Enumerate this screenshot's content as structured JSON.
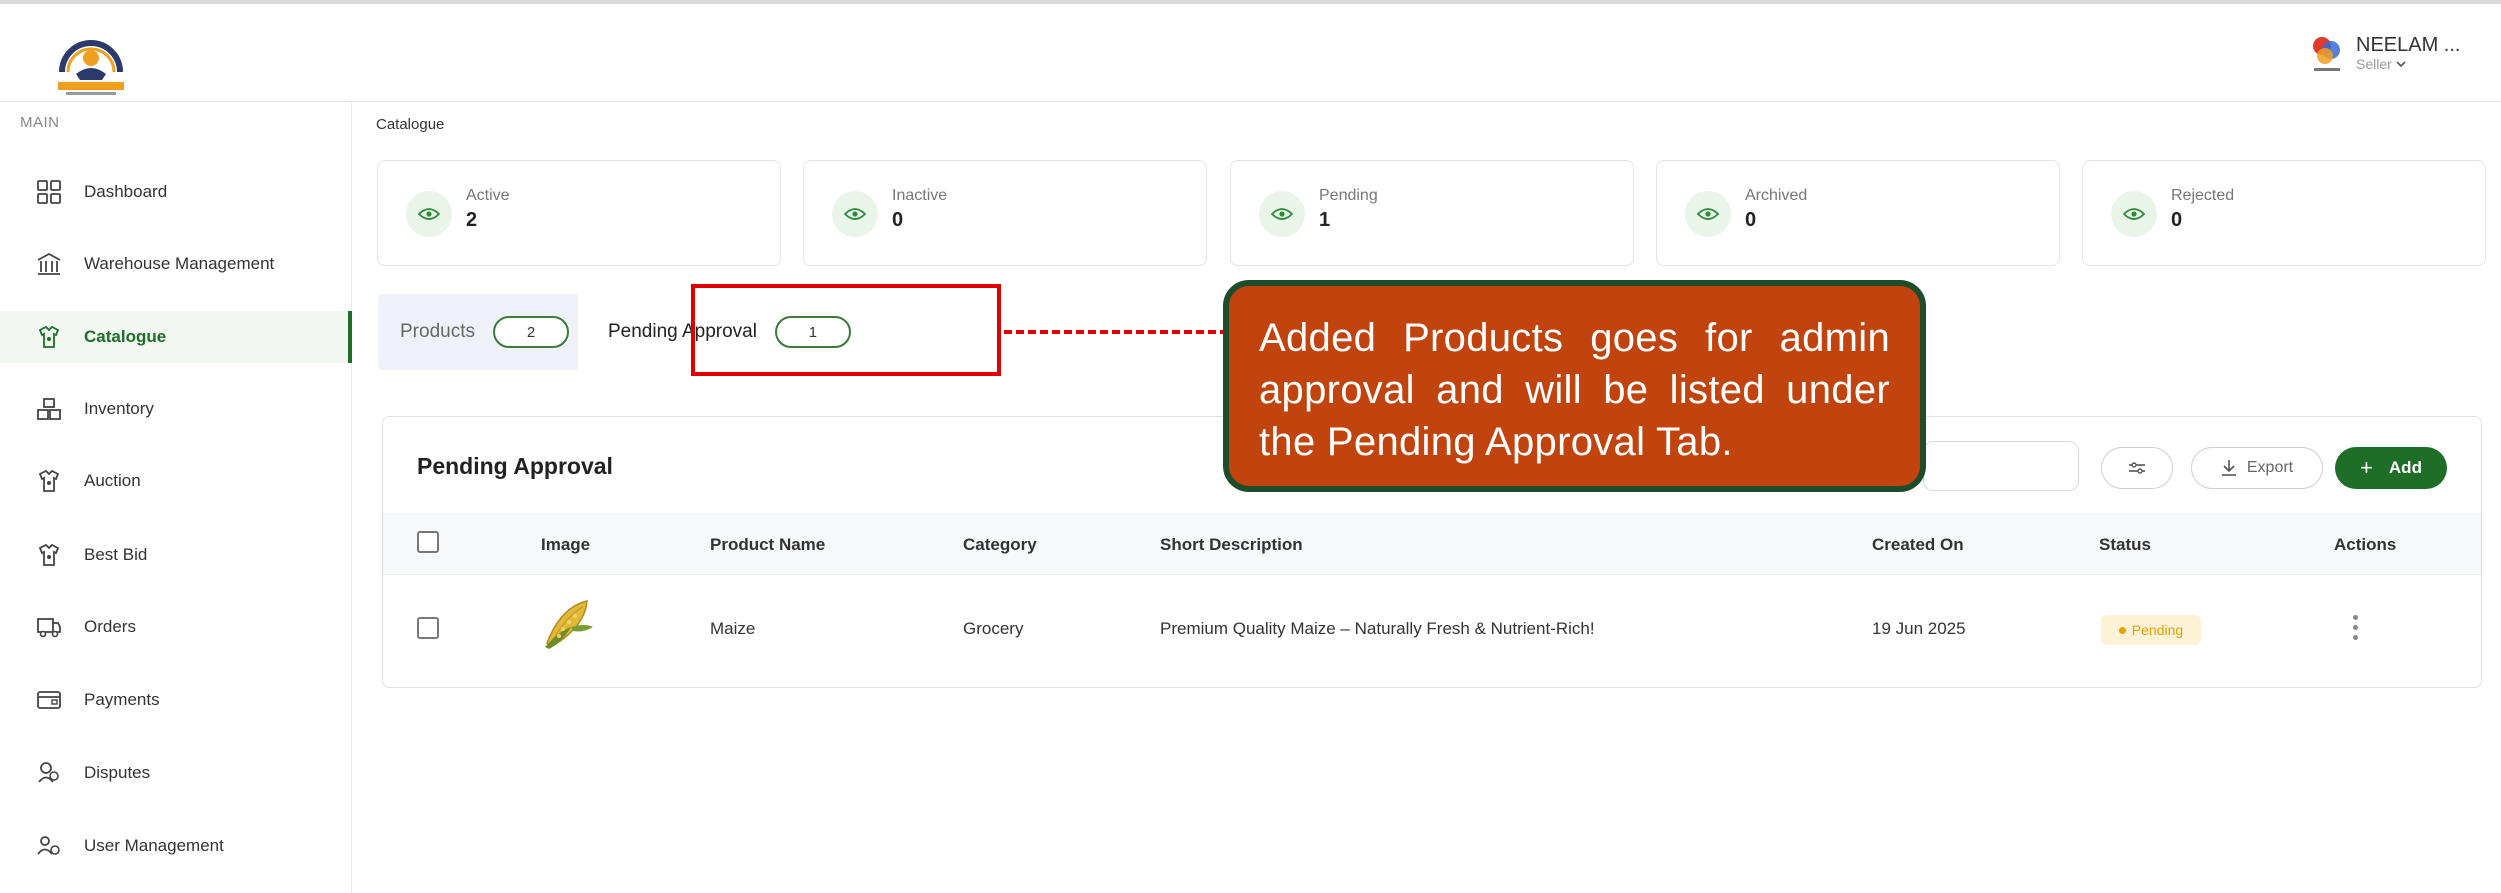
{
  "user": {
    "name": "NEELAM ...",
    "role": "Seller"
  },
  "sidebar": {
    "section": "MAIN",
    "items": [
      {
        "label": "Dashboard",
        "icon": "grid-icon"
      },
      {
        "label": "Warehouse Management",
        "icon": "warehouse-icon"
      },
      {
        "label": "Catalogue",
        "icon": "catalogue-icon",
        "active": true
      },
      {
        "label": "Inventory",
        "icon": "inventory-icon"
      },
      {
        "label": "Auction",
        "icon": "auction-icon"
      },
      {
        "label": "Best Bid",
        "icon": "best-bid-icon"
      },
      {
        "label": "Orders",
        "icon": "orders-icon"
      },
      {
        "label": "Payments",
        "icon": "payments-icon"
      },
      {
        "label": "Disputes",
        "icon": "disputes-icon"
      },
      {
        "label": "User Management",
        "icon": "users-icon"
      }
    ]
  },
  "breadcrumb": "Catalogue",
  "stats": [
    {
      "label": "Active",
      "value": "2"
    },
    {
      "label": "Inactive",
      "value": "0"
    },
    {
      "label": "Pending",
      "value": "1"
    },
    {
      "label": "Archived",
      "value": "0"
    },
    {
      "label": "Rejected",
      "value": "0"
    }
  ],
  "tabs": [
    {
      "label": "Products",
      "count": "2"
    },
    {
      "label": "Pending Approval",
      "count": "1"
    }
  ],
  "callout": "Added Products goes for admin approval and will be listed under the Pending Approval Tab.",
  "table": {
    "title": "Pending Approval",
    "export_label": "Export",
    "add_label": "Add",
    "columns": [
      "Image",
      "Product Name",
      "Category",
      "Short Description",
      "Created On",
      "Status",
      "Actions"
    ],
    "rows": [
      {
        "product": "Maize",
        "category": "Grocery",
        "description": "Premium Quality Maize – Naturally Fresh & Nutrient-Rich!",
        "created": "19 Jun 2025",
        "status": "Pending"
      }
    ]
  },
  "colors": {
    "brand_green": "#1f6e28",
    "callout_bg": "#c1440e",
    "callout_border": "#1e4d2b",
    "highlight_red": "#e00000",
    "pending": "#e6a000"
  }
}
